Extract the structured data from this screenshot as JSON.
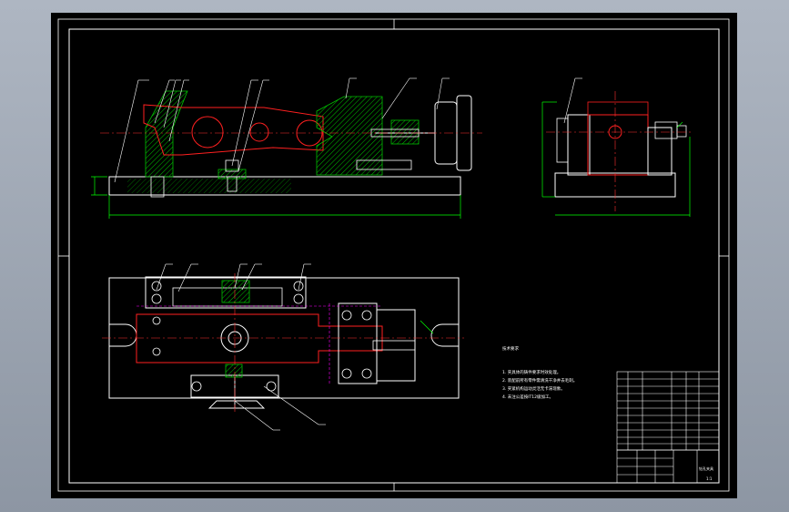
{
  "drawing": {
    "colors": {
      "frame_bg": "#000000",
      "outline": "#ffffff",
      "part_red": "#ff2020",
      "hatch_green": "#00c000",
      "dimension_green": "#00ff00",
      "centerline": "#ff3030",
      "hidden_magenta": "#ff00ff",
      "leader_white": "#ffffff"
    },
    "tech_requirements": {
      "title": "技术要求",
      "items": [
        "1. 夹具体的铸件要求时效处理。",
        "2. 装配前所有零件需清洗干净并去毛刺。",
        "3. 夹紧机构运动灵活无卡滞现象。",
        "4. 未注公差按IT12级加工。"
      ]
    },
    "title_block": {
      "drawing_title": "钻孔夹具",
      "sheet_label": "1:1"
    }
  }
}
